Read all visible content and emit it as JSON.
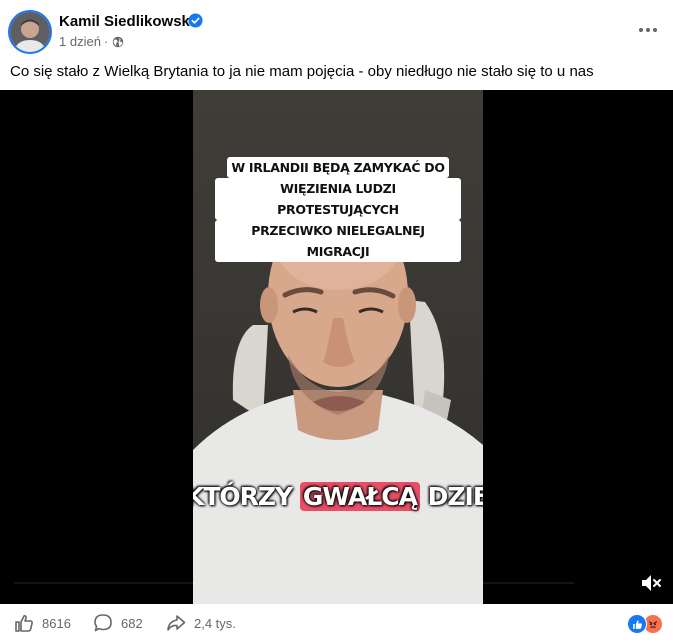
{
  "post": {
    "author": {
      "name": "Kamil Siedlikowski",
      "verified": true,
      "avatar_icon": "user-avatar"
    },
    "timestamp": "1 dzień",
    "separator": "·",
    "audience_icon": "globe-icon",
    "more_icon": "more-dots-icon",
    "caption": "Co się stało z Wielką Brytania to ja nie mam pojęcia - oby niedługo nie stało się to u nas"
  },
  "video": {
    "overlay_top_lines": [
      "W IRLANDII BĘDĄ ZAMYKAĆ DO",
      "WIĘZIENIA LUDZI PROTESTUJĄCYCH",
      "PRZECIWKO NIELEGALNEJ MIGRACJI"
    ],
    "overlay_bottom_pre": "KTÓRZY ",
    "overlay_bottom_highlight": "GWAŁCĄ",
    "overlay_bottom_post": " DZIEWCZYNKI",
    "highlight_color": "#e84f67",
    "mute_icon": "speaker-muted-icon",
    "muted": true
  },
  "footer": {
    "likes_count": "8616",
    "comments_count": "682",
    "shares_count": "2,4 tys.",
    "like_icon": "thumbs-up-icon",
    "comment_icon": "comment-bubble-icon",
    "share_icon": "share-arrow-icon",
    "reaction_icons": [
      "like-reaction-icon",
      "angry-reaction-icon"
    ]
  },
  "colors": {
    "brand": "#1877f2",
    "secondary_text": "#65676b",
    "angry": "#f7714c"
  }
}
